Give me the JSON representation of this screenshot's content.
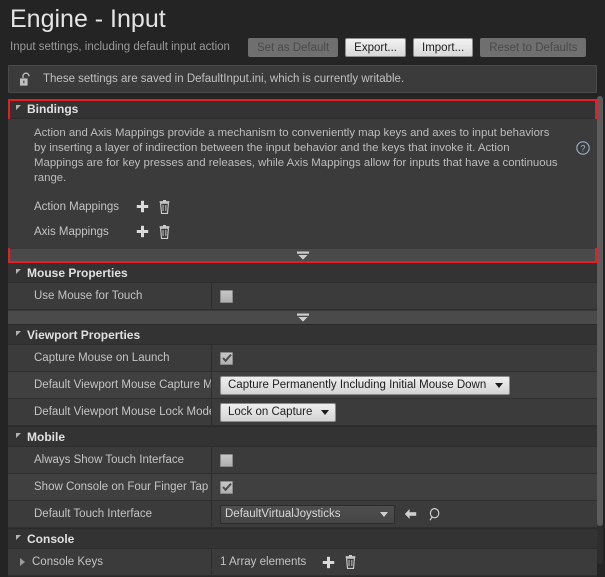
{
  "header": {
    "title": "Engine - Input",
    "subtitle": "Input settings, including default input action",
    "buttons": [
      {
        "label": "Set as Default",
        "state": "disabled"
      },
      {
        "label": "Export...",
        "state": "enabled"
      },
      {
        "label": "Import...",
        "state": "enabled"
      },
      {
        "label": "Reset to Defaults",
        "state": "disabled"
      }
    ]
  },
  "notice": {
    "icon": "unlocked-padlock-icon",
    "text": "These settings are saved in DefaultInput.ini, which is currently writable."
  },
  "sections": {
    "bindings": {
      "title": "Bindings",
      "highlighted": true,
      "highlight_color": "#ed1c24",
      "description": "Action and Axis Mappings provide a mechanism to conveniently map keys and axes to input behaviors by inserting a layer of indirection between the input behavior and the keys that invoke it. Action Mappings are for key presses and releases, while Axis Mappings allow for inputs that have a continuous range.",
      "help_icon": "question-circle-icon",
      "rows": [
        {
          "label": "Action Mappings",
          "add": "plus-icon",
          "clear": "trash-icon"
        },
        {
          "label": "Axis Mappings",
          "add": "plus-icon",
          "clear": "trash-icon"
        }
      ]
    },
    "mouse_properties": {
      "title": "Mouse Properties",
      "rows": [
        {
          "label": "Use Mouse for Touch",
          "type": "checkbox",
          "checked": false
        }
      ]
    },
    "viewport_properties": {
      "title": "Viewport Properties",
      "rows": [
        {
          "label": "Capture Mouse on Launch",
          "type": "checkbox",
          "checked": true
        },
        {
          "label": "Default Viewport Mouse Capture M",
          "type": "combo",
          "value": "Capture Permanently Including Initial Mouse Down"
        },
        {
          "label": "Default Viewport Mouse Lock Mode",
          "type": "combo",
          "value": "Lock on Capture"
        }
      ]
    },
    "mobile": {
      "title": "Mobile",
      "rows": [
        {
          "label": "Always Show Touch Interface",
          "type": "checkbox",
          "checked": false
        },
        {
          "label": "Show Console on Four Finger Tap",
          "type": "checkbox",
          "checked": true
        },
        {
          "label": "Default Touch Interface",
          "type": "asset",
          "value": "DefaultVirtualJoysticks",
          "use_icon": "arrow-left-icon",
          "browse_icon": "magnifier-icon"
        }
      ]
    },
    "console": {
      "title": "Console",
      "rows": [
        {
          "label": "Console Keys",
          "type": "array",
          "value": "1 Array elements",
          "add": "plus-icon",
          "clear": "trash-icon"
        }
      ]
    }
  }
}
